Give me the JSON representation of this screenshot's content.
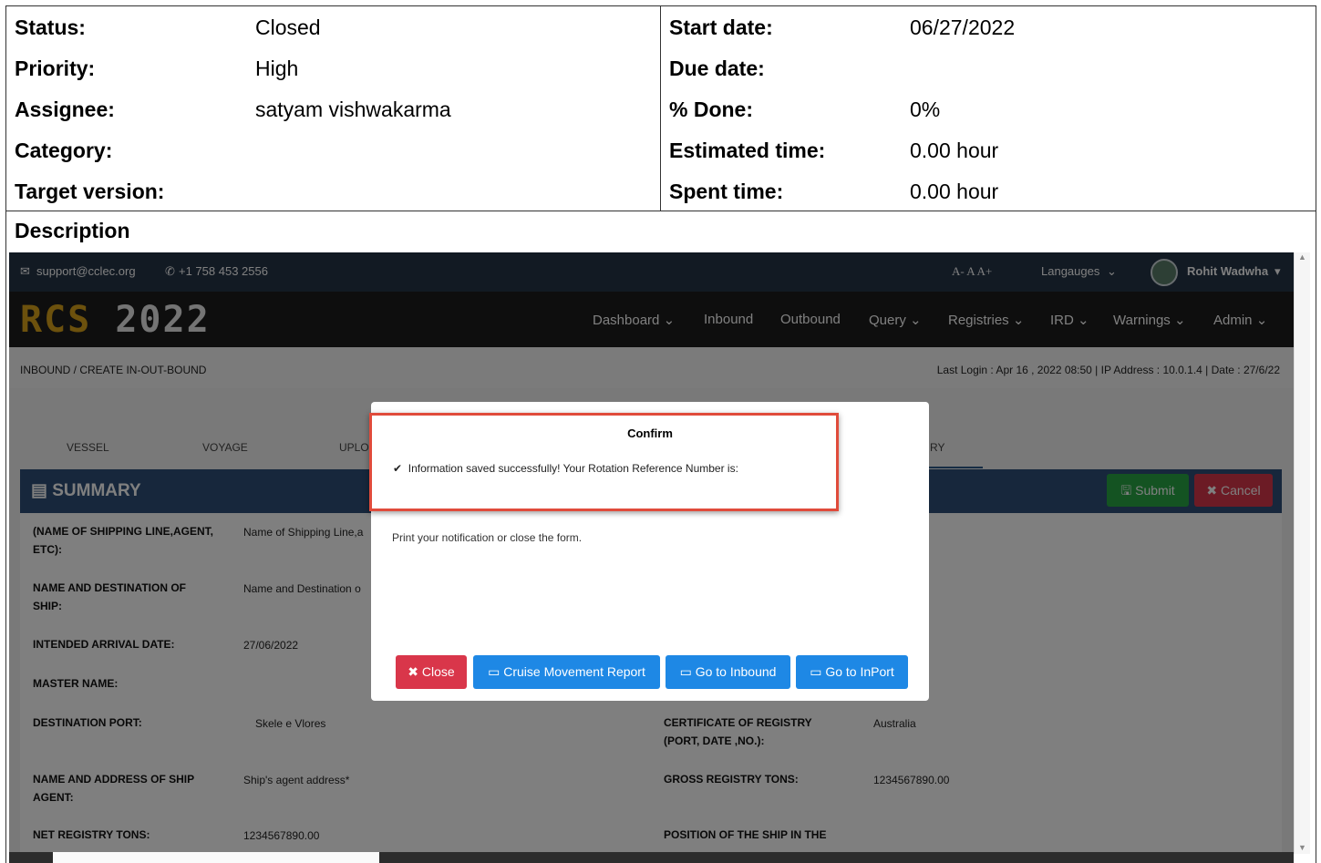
{
  "attributes": {
    "left": [
      {
        "label": "Status:",
        "value": "Closed"
      },
      {
        "label": "Priority:",
        "value": "High"
      },
      {
        "label": "Assignee:",
        "value": "satyam vishwakarma"
      },
      {
        "label": "Category:",
        "value": ""
      },
      {
        "label": "Target version:",
        "value": ""
      }
    ],
    "right": [
      {
        "label": "Start date:",
        "value": "06/27/2022"
      },
      {
        "label": "Due date:",
        "value": ""
      },
      {
        "label": "% Done:",
        "value": "0%"
      },
      {
        "label": "Estimated time:",
        "value": "0.00 hour"
      },
      {
        "label": "Spent time:",
        "value": "0.00 hour"
      }
    ]
  },
  "description_label": "Description",
  "screenshot": {
    "topbar": {
      "email": "support@cclec.org",
      "phone": "+1 758 453 2556",
      "font_sizes": "A- A A+",
      "languages": "Langauges",
      "user": "Rohit Wadwha"
    },
    "logo": {
      "brand": "RCS",
      "year": "2022"
    },
    "nav": [
      "Dashboard",
      "Inbound",
      "Outbound",
      "Query",
      "Registries",
      "IRD",
      "Warnings",
      "Admin"
    ],
    "breadcrumb": "INBOUND  /  CREATE IN-OUT-BOUND",
    "last_login": "Last Login : Apr 16 , 2022 08:50 | IP Address : 10.0.1.4 | Date : 27/6/22",
    "tabs": [
      "VESSEL",
      "VOYAGE",
      "UPLO",
      "RY"
    ],
    "panel": {
      "title": "SUMMARY",
      "submit": "Submit",
      "cancel": "Cancel"
    },
    "form": {
      "shipping_line_label": "(NAME OF SHIPPING LINE,AGENT, ETC):",
      "shipping_line_value": "Name of Shipping Line,a",
      "destination_ship_label": "NAME AND DESTINATION OF SHIP:",
      "destination_ship_value": "Name and Destination o",
      "arrival_label": "INTENDED ARRIVAL DATE:",
      "arrival_value": "27/06/2022",
      "master_label": "MASTER NAME:",
      "dest_port_label": "DESTINATION PORT:",
      "dest_port_value": "Skele e Vlores",
      "cert_label": "CERTIFICATE OF REGISTRY (PORT, DATE ,NO.):",
      "cert_value": "Australia",
      "agent_label": "NAME AND ADDRESS OF SHIP AGENT:",
      "agent_value": "Ship's agent address*",
      "gross_label": "GROSS REGISTRY TONS:",
      "gross_value": "1234567890.00",
      "net_label": "NET REGISTRY TONS:",
      "net_value": "1234567890.00",
      "position_label": "POSITION OF THE SHIP IN THE"
    },
    "modal": {
      "title": "Confirm",
      "message": "Information saved successfully! Your Rotation Reference Number is:",
      "sub": "Print your notification or close the form.",
      "buttons": {
        "close": "Close",
        "cruise": "Cruise Movement Report",
        "inbound": "Go to Inbound",
        "inport": "Go to InPort"
      }
    }
  }
}
